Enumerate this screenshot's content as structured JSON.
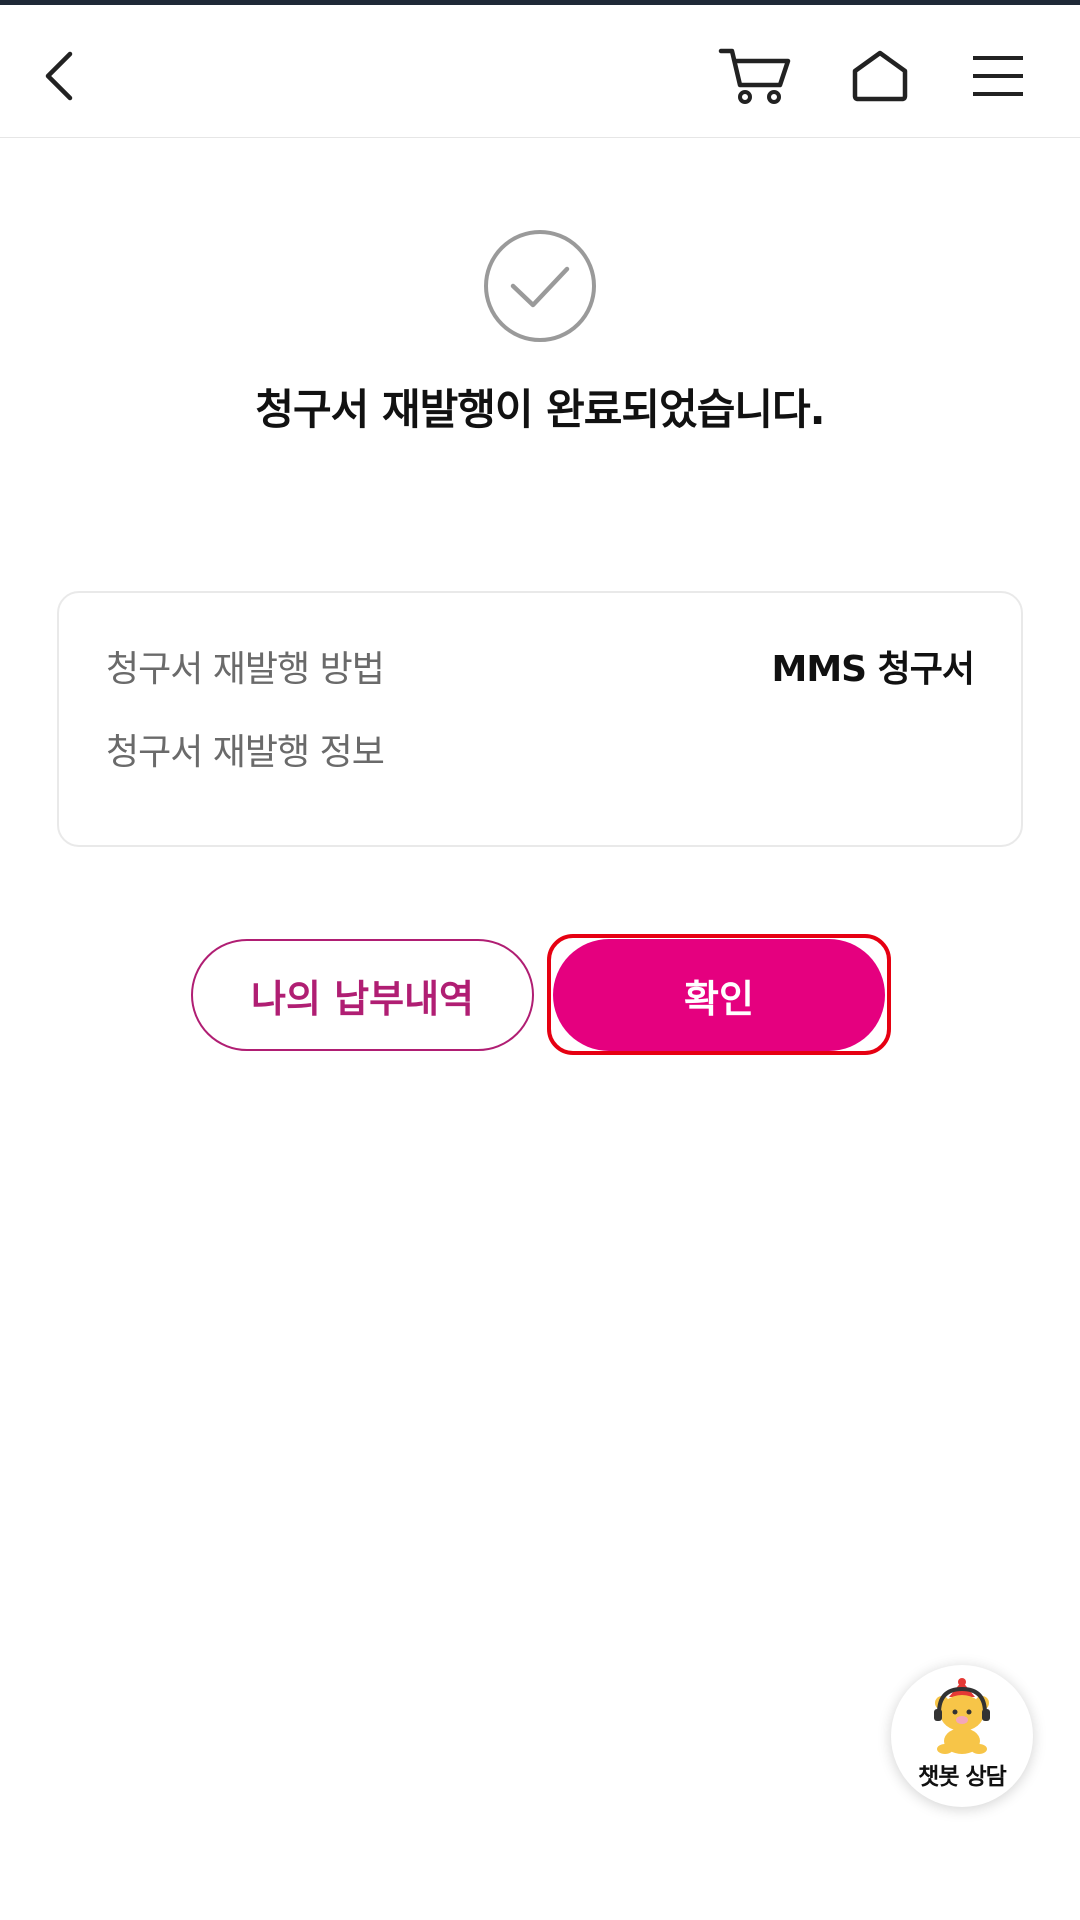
{
  "header": {
    "back_icon": "chevron-left-icon",
    "cart_icon": "cart-icon",
    "home_icon": "home-icon",
    "menu_icon": "hamburger-menu-icon"
  },
  "status": {
    "icon": "check-circle-icon",
    "message": "청구서 재발행이 완료되었습니다."
  },
  "details": {
    "rows": [
      {
        "label": "청구서 재발행 방법",
        "value": "MMS 청구서"
      },
      {
        "label": "청구서 재발행 정보",
        "value": ""
      }
    ]
  },
  "actions": {
    "history_label": "나의 납부내역",
    "confirm_label": "확인"
  },
  "chatbot": {
    "label": "챗봇 상담"
  },
  "colors": {
    "brand": "#e5007f",
    "outline_accent": "#b01e73",
    "highlight": "#e60012"
  }
}
